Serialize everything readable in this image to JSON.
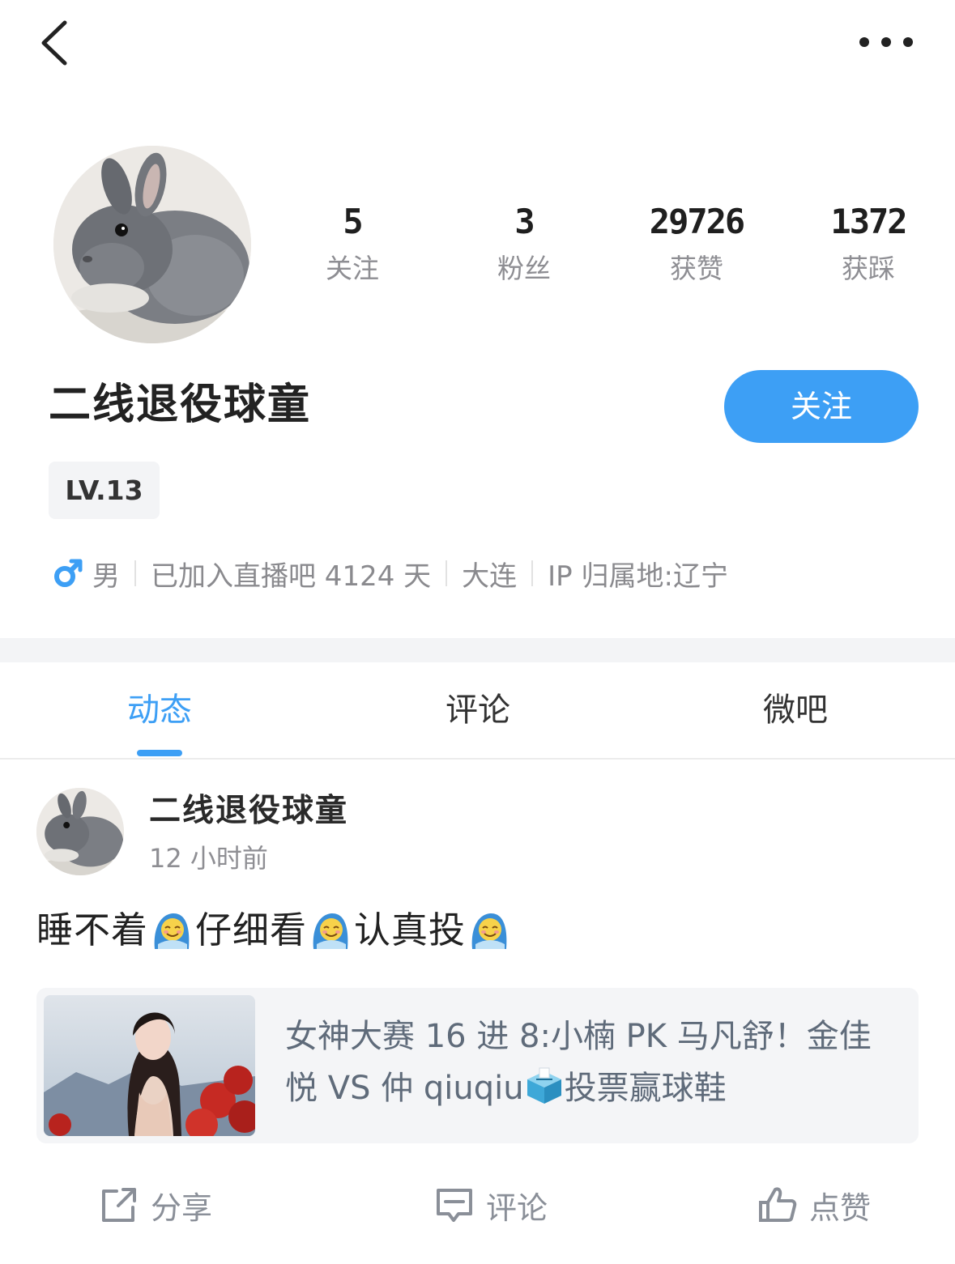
{
  "header": {
    "back_icon": "chevron-left-icon",
    "more_icon": "more-horizontal-icon"
  },
  "profile": {
    "stats": [
      {
        "value": "5",
        "label": "关注"
      },
      {
        "value": "3",
        "label": "粉丝"
      },
      {
        "value": "29726",
        "label": "获赞"
      },
      {
        "value": "1372",
        "label": "获踩"
      }
    ],
    "username": "二线退役球童",
    "follow_label": "关注",
    "level": "LV.13",
    "gender": "男",
    "joined": "已加入直播吧 4124 天",
    "city": "大连",
    "ip": "IP 归属地:辽宁"
  },
  "tabs": [
    {
      "label": "动态",
      "active": true
    },
    {
      "label": "评论",
      "active": false
    },
    {
      "label": "微吧",
      "active": false
    }
  ],
  "post": {
    "author": "二线退役球童",
    "time": "12 小时前",
    "text_parts": [
      "睡不着",
      "仔细看",
      "认真投"
    ],
    "card": {
      "title_before": "女神大赛 16 进 8:小楠 PK 马凡舒！金佳悦 VS 仲 qiuqiu",
      "title_after": "投票赢球鞋"
    },
    "actions": {
      "share": "分享",
      "comment": "评论",
      "like": "点赞"
    }
  },
  "colors": {
    "accent": "#3d9ff5",
    "muted": "#8e8e93",
    "band": "#f3f4f6"
  }
}
